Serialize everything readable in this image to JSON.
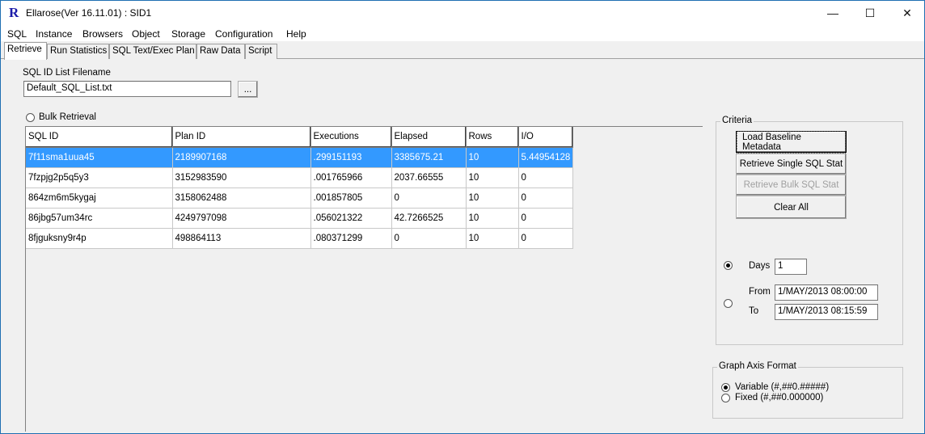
{
  "window": {
    "logo": "R",
    "title": "Ellarose(Ver 16.11.01) : SID1",
    "controls": {
      "minimize": "—",
      "maximize": "☐",
      "close": "✕"
    }
  },
  "menu": [
    "SQL",
    "Instance",
    "Browsers",
    "Object",
    "Storage",
    "Configuration",
    "Help"
  ],
  "tabs": [
    "Retrieve",
    "Run Statistics",
    "SQL Text/Exec Plan",
    "Raw Data",
    "Script"
  ],
  "active_tab": "Retrieve",
  "retrieve": {
    "sql_id_list_label": "SQL ID List Filename",
    "sql_id_list_value": "Default_SQL_List.txt",
    "browse_label": "...",
    "bulk_retrieval_label": "Bulk Retrieval",
    "grid": {
      "columns": [
        "SQL ID",
        "Plan ID",
        "Executions",
        "Elapsed",
        "Rows",
        "I/O"
      ],
      "rows": [
        [
          "7f11sma1uua45",
          "2189907168",
          ".299151193",
          "3385675.21",
          "10",
          "5.44954128"
        ],
        [
          "7fzpjg2p5q5y3",
          "3152983590",
          ".001765966",
          "2037.66555",
          "10",
          "0"
        ],
        [
          "864zm6m5kygaj",
          "3158062488",
          ".001857805",
          "0",
          "10",
          "0"
        ],
        [
          "86jbg57um34rc",
          "4249797098",
          ".056021322",
          "42.7266525",
          "10",
          "0"
        ],
        [
          "8fjguksny9r4p",
          "498864113",
          ".080371299",
          "0",
          "10",
          "0"
        ]
      ],
      "selected_row": 0
    },
    "criteria": {
      "title": "Criteria",
      "buttons": {
        "load_baseline": "Load Baseline Metadata",
        "retrieve_single": "Retrieve Single SQL Stat",
        "retrieve_bulk": "Retrieve Bulk SQL Stat",
        "clear_all": "Clear All"
      },
      "days_label": "Days",
      "days_value": "1",
      "from_label": "From",
      "from_value": "1/MAY/2013 08:00:00",
      "to_label": "To",
      "to_value": "1/MAY/2013 08:15:59"
    },
    "graph_axis": {
      "title": "Graph Axis Format",
      "variable_label": "Variable (#,##0.#####)",
      "fixed_label": "Fixed (#,##0.000000)"
    }
  }
}
